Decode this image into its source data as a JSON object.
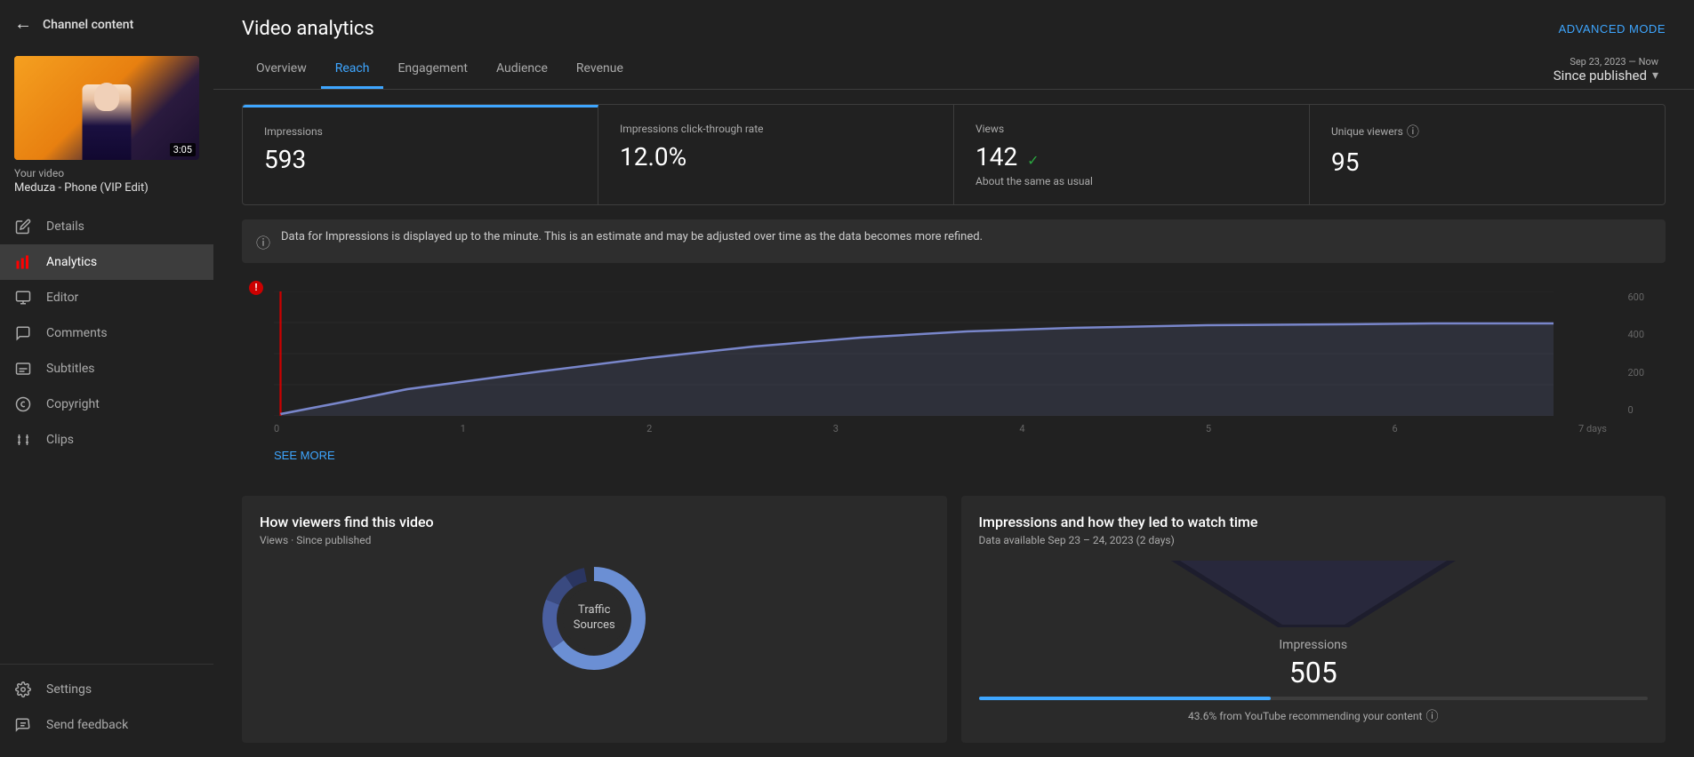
{
  "sidebar": {
    "back_label": "←",
    "channel_label": "Channel content",
    "video": {
      "duration": "3:05",
      "your_video_label": "Your video",
      "name": "Meduza - Phone (VIP Edit)"
    },
    "nav_items": [
      {
        "id": "details",
        "label": "Details",
        "icon": "✏️",
        "active": false
      },
      {
        "id": "analytics",
        "label": "Analytics",
        "icon": "📊",
        "active": true
      },
      {
        "id": "editor",
        "label": "Editor",
        "icon": "🎬",
        "active": false
      },
      {
        "id": "comments",
        "label": "Comments",
        "icon": "💬",
        "active": false
      },
      {
        "id": "subtitles",
        "label": "Subtitles",
        "icon": "🔡",
        "active": false
      },
      {
        "id": "copyright",
        "label": "Copyright",
        "icon": "©",
        "active": false
      },
      {
        "id": "clips",
        "label": "Clips",
        "icon": "✂️",
        "active": false
      }
    ],
    "bottom_items": [
      {
        "id": "settings",
        "label": "Settings",
        "icon": "⚙️"
      },
      {
        "id": "send-feedback",
        "label": "Send feedback",
        "icon": "📋"
      }
    ]
  },
  "header": {
    "title": "Video analytics",
    "advanced_mode_label": "ADVANCED MODE"
  },
  "tabs": [
    {
      "id": "overview",
      "label": "Overview",
      "active": false
    },
    {
      "id": "reach",
      "label": "Reach",
      "active": true
    },
    {
      "id": "engagement",
      "label": "Engagement",
      "active": false
    },
    {
      "id": "audience",
      "label": "Audience",
      "active": false
    },
    {
      "id": "revenue",
      "label": "Revenue",
      "active": false
    }
  ],
  "date_range": {
    "range_text": "Sep 23, 2023 — Now",
    "value": "Since published"
  },
  "stats": [
    {
      "id": "impressions",
      "label": "Impressions",
      "value": "593",
      "sub": "",
      "active": true,
      "has_info": false,
      "has_check": false
    },
    {
      "id": "ctr",
      "label": "Impressions click-through rate",
      "value": "12.0%",
      "sub": "",
      "active": false,
      "has_info": false,
      "has_check": false
    },
    {
      "id": "views",
      "label": "Views",
      "value": "142",
      "sub": "About the same as usual",
      "active": false,
      "has_info": false,
      "has_check": true
    },
    {
      "id": "unique_viewers",
      "label": "Unique viewers",
      "value": "95",
      "sub": "",
      "active": false,
      "has_info": true,
      "has_check": false
    }
  ],
  "info_banner": {
    "text": "Data for Impressions is displayed up to the minute. This is an estimate and may be adjusted over time as the data becomes more refined."
  },
  "chart": {
    "x_labels": [
      "0",
      "1",
      "2",
      "3",
      "4",
      "5",
      "6",
      "7 days"
    ],
    "y_labels": [
      "600",
      "400",
      "200",
      "0"
    ],
    "see_more_label": "SEE MORE"
  },
  "bottom_left_card": {
    "title": "How viewers find this video",
    "sub": "Views · Since published",
    "donut_label_line1": "Traffic",
    "donut_label_line2": "Sources"
  },
  "bottom_right_card": {
    "title": "Impressions and how they led to watch time",
    "sub": "Data available Sep 23 – 24, 2023 (2 days)",
    "impressions_label": "Impressions",
    "impressions_value": "505",
    "bar_label": "43.6% from YouTube recommending your content"
  }
}
